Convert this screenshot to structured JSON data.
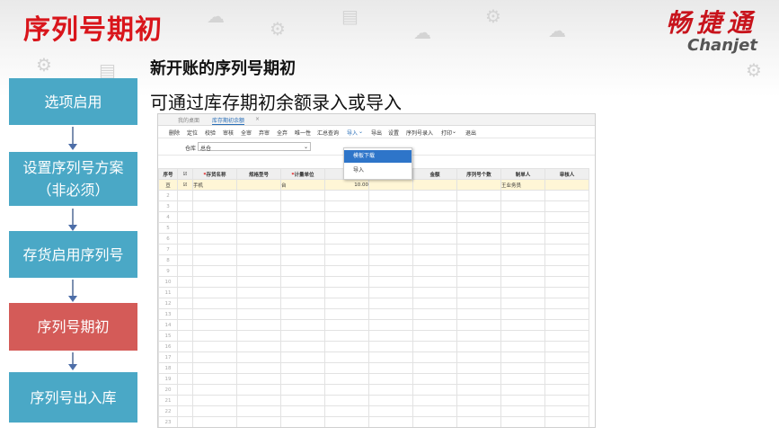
{
  "slide": {
    "title": "序列号期初",
    "logo_cn": "畅捷通",
    "logo_en": "Chanjet",
    "heading": "新开账的序列号期初",
    "subheading": "可通过库存期初余额录入或导入"
  },
  "steps": [
    {
      "label": "选项启用",
      "active": false
    },
    {
      "label": "设置序列号方案（非必须）",
      "active": false
    },
    {
      "label": "存货启用序列号",
      "active": false
    },
    {
      "label": "序列号期初",
      "active": true
    },
    {
      "label": "序列号出入库",
      "active": false
    }
  ],
  "app": {
    "tabs": [
      "我的桌面",
      "库存期初余额"
    ],
    "toolbar": [
      "删除",
      "定位",
      "校验",
      "审核",
      "全审",
      "弃审",
      "全弃",
      "唯一性",
      "汇总查询",
      "导入",
      "导出",
      "设置",
      "序列号录入",
      "打印",
      "退出"
    ],
    "filter_label": "仓库",
    "warehouse_value": "总仓",
    "import_menu": [
      "模板下载",
      "导入"
    ],
    "columns": [
      "序号",
      "",
      "存货名称",
      "规格型号",
      "计量单位",
      "",
      "",
      "金额",
      "序列号个数",
      "制单人",
      "审核人"
    ],
    "row1": {
      "num": "1",
      "item": "手机",
      "unit": "台",
      "qty": "10.00",
      "maker": "王业务员"
    },
    "empty_rows": 24
  }
}
